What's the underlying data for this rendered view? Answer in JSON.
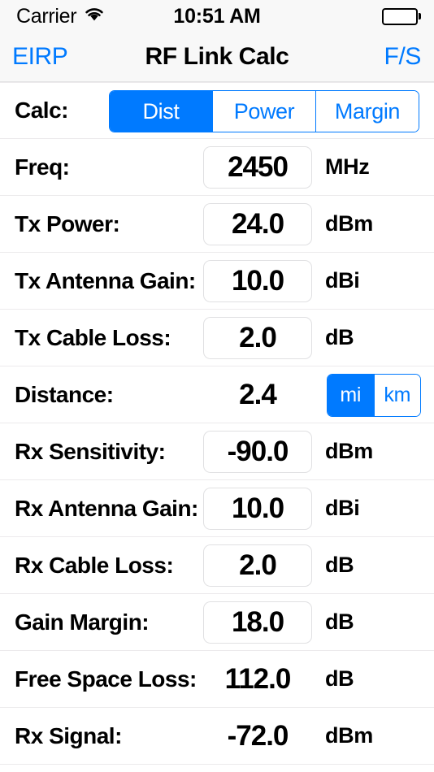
{
  "status_bar": {
    "carrier": "Carrier",
    "wifi_icon": "wifi-icon",
    "time": "10:51 AM",
    "battery_icon": "battery-full-icon"
  },
  "nav_bar": {
    "left_button": "EIRP",
    "title": "RF Link Calc",
    "right_button": "F/S"
  },
  "colors": {
    "accent": "#007AFF",
    "bar_background": "#F8F8F8",
    "divider": "#ECEAEC",
    "field_border": "#E0E0E2"
  },
  "calc_mode": {
    "label": "Calc:",
    "options": [
      "Dist",
      "Power",
      "Margin"
    ],
    "selected": "Dist"
  },
  "distance_units": {
    "options": [
      "mi",
      "km"
    ],
    "selected": "mi"
  },
  "rows": [
    {
      "label": "Freq:",
      "value": "2450",
      "unit": "MHz",
      "editable": true
    },
    {
      "label": "Tx Power:",
      "value": "24.0",
      "unit": "dBm",
      "editable": true
    },
    {
      "label": "Tx Antenna Gain:",
      "value": "10.0",
      "unit": "dBi",
      "editable": true
    },
    {
      "label": "Tx Cable Loss:",
      "value": "2.0",
      "unit": "dB",
      "editable": true
    },
    {
      "label": "Distance:",
      "value": "2.4",
      "unit": "",
      "editable": false
    },
    {
      "label": "Rx Sensitivity:",
      "value": "-90.0",
      "unit": "dBm",
      "editable": true
    },
    {
      "label": "Rx Antenna Gain:",
      "value": "10.0",
      "unit": "dBi",
      "editable": true
    },
    {
      "label": "Rx Cable Loss:",
      "value": "2.0",
      "unit": "dB",
      "editable": true
    },
    {
      "label": "Gain Margin:",
      "value": "18.0",
      "unit": "dB",
      "editable": true
    },
    {
      "label": "Free Space Loss:",
      "value": "112.0",
      "unit": "dB",
      "editable": false
    },
    {
      "label": "Rx Signal:",
      "value": "-72.0",
      "unit": "dBm",
      "editable": false
    }
  ]
}
